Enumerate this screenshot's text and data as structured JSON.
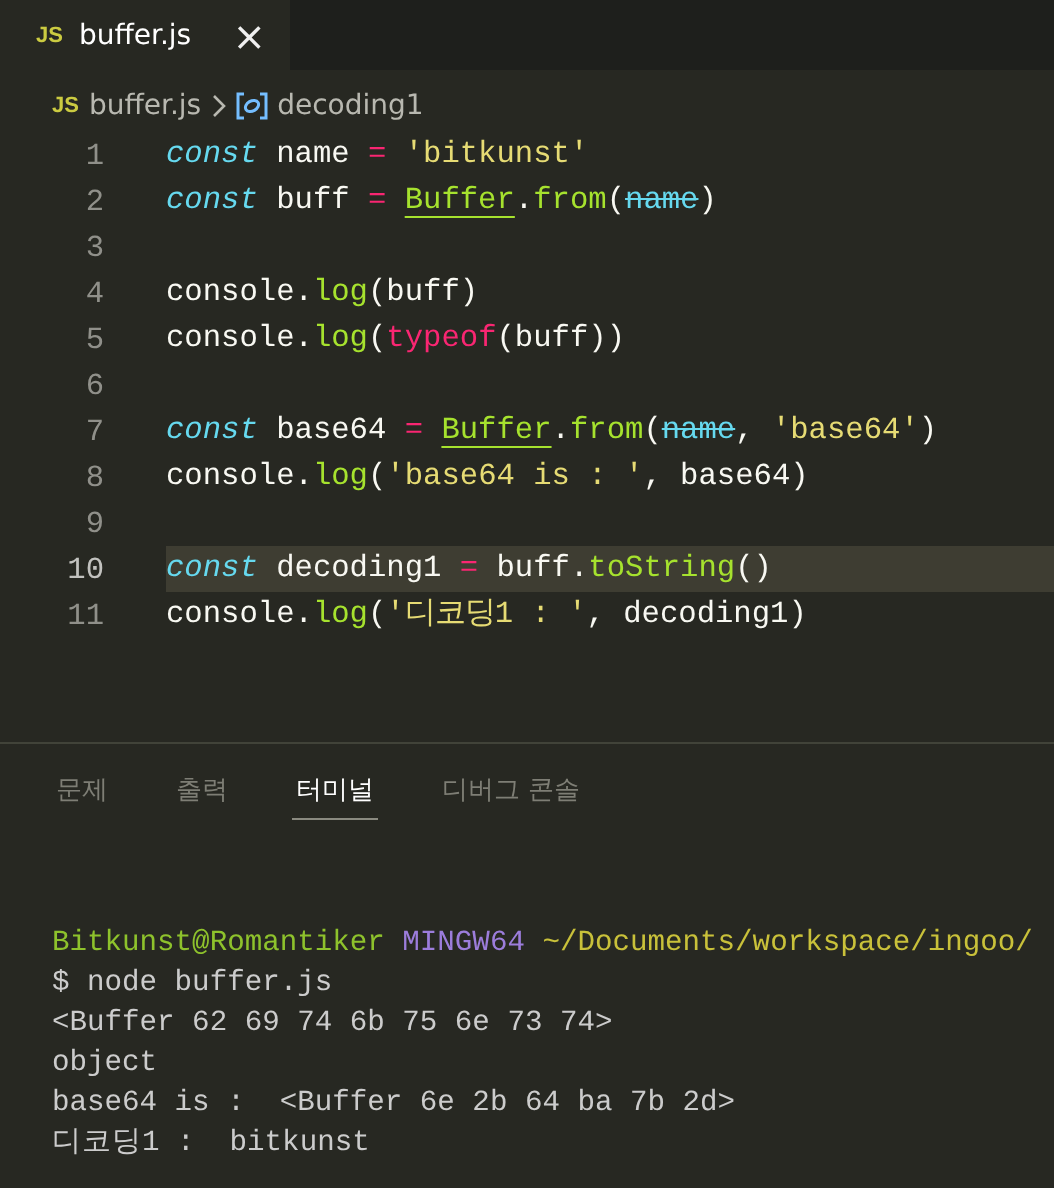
{
  "tab": {
    "icon": "JS",
    "title": "buffer.js",
    "close": "×",
    "selected": true
  },
  "breadcrumb": {
    "icon": "JS",
    "file": "buffer.js",
    "symbol": "decoding1"
  },
  "code_lines": [
    {
      "number": "1",
      "current": false,
      "tokens": [
        {
          "kind": "keyword",
          "text": "const"
        },
        {
          "kind": "plain",
          "text": " name "
        },
        {
          "kind": "operator",
          "text": "= "
        },
        {
          "kind": "string",
          "text": "'bitkunst'"
        }
      ]
    },
    {
      "number": "2",
      "current": false,
      "tokens": [
        {
          "kind": "keyword",
          "text": "const"
        },
        {
          "kind": "plain",
          "text": " buff "
        },
        {
          "kind": "operator",
          "text": "= "
        },
        {
          "kind": "class",
          "text": "Buffer"
        },
        {
          "kind": "plain",
          "text": "."
        },
        {
          "kind": "function",
          "text": "from"
        },
        {
          "kind": "plain",
          "text": "("
        },
        {
          "kind": "deprecated",
          "text": "name"
        },
        {
          "kind": "plain",
          "text": ")"
        }
      ]
    },
    {
      "number": "3",
      "current": false
    },
    {
      "number": "4",
      "current": false,
      "tokens": [
        {
          "kind": "plain",
          "text": "console."
        },
        {
          "kind": "function",
          "text": "log"
        },
        {
          "kind": "plain",
          "text": "(buff)"
        }
      ]
    },
    {
      "number": "5",
      "current": false,
      "tokens": [
        {
          "kind": "plain",
          "text": "console."
        },
        {
          "kind": "function",
          "text": "log"
        },
        {
          "kind": "plain",
          "text": "("
        },
        {
          "kind": "operator",
          "text": "typeof"
        },
        {
          "kind": "plain",
          "text": "(buff))"
        }
      ]
    },
    {
      "number": "6",
      "current": false
    },
    {
      "number": "7",
      "current": false,
      "tokens": [
        {
          "kind": "keyword",
          "text": "const"
        },
        {
          "kind": "plain",
          "text": " base64 "
        },
        {
          "kind": "operator",
          "text": "= "
        },
        {
          "kind": "class",
          "text": "Buffer"
        },
        {
          "kind": "plain",
          "text": "."
        },
        {
          "kind": "function",
          "text": "from"
        },
        {
          "kind": "plain",
          "text": "("
        },
        {
          "kind": "deprecated",
          "text": "name"
        },
        {
          "kind": "plain",
          "text": ", "
        },
        {
          "kind": "string",
          "text": "'base64'"
        },
        {
          "kind": "plain",
          "text": ")"
        }
      ]
    },
    {
      "number": "8",
      "current": false,
      "tokens": [
        {
          "kind": "plain",
          "text": "console."
        },
        {
          "kind": "function",
          "text": "log"
        },
        {
          "kind": "plain",
          "text": "("
        },
        {
          "kind": "string",
          "text": "'base64 is : '"
        },
        {
          "kind": "plain",
          "text": ", base64)"
        }
      ]
    },
    {
      "number": "9",
      "current": false
    },
    {
      "number": "10",
      "current": true,
      "tokens": [
        {
          "kind": "keyword",
          "text": "const"
        },
        {
          "kind": "plain",
          "text": " decoding1 "
        },
        {
          "kind": "operator",
          "text": "="
        },
        {
          "kind": "plain",
          "text": " buff."
        },
        {
          "kind": "function",
          "text": "toString"
        },
        {
          "kind": "plain",
          "text": "()"
        }
      ]
    },
    {
      "number": "11",
      "current": false,
      "tokens": [
        {
          "kind": "plain",
          "text": "console."
        },
        {
          "kind": "function",
          "text": "log"
        },
        {
          "kind": "plain",
          "text": "("
        },
        {
          "kind": "string",
          "text": "'디코딩1 : '"
        },
        {
          "kind": "plain",
          "text": ", decoding1)"
        }
      ]
    }
  ],
  "panel_tabs": [
    {
      "label": "문제",
      "selected": false
    },
    {
      "label": "출력",
      "selected": false
    },
    {
      "label": "터미널",
      "selected": true
    },
    {
      "label": "디버그 콘솔",
      "selected": false
    }
  ],
  "terminal_lines": [
    [
      {
        "kind": "user",
        "text": "Bitkunst@Romantiker "
      },
      {
        "kind": "system",
        "text": "MINGW64 "
      },
      {
        "kind": "path",
        "text": "~/Documents/workspace/ingoo/"
      }
    ],
    [
      {
        "kind": "plain",
        "text": "$ node buffer.js"
      }
    ],
    [
      {
        "kind": "plain",
        "text": "<Buffer 62 69 74 6b 75 6e 73 74>"
      }
    ],
    [
      {
        "kind": "plain",
        "text": "object"
      }
    ],
    [
      {
        "kind": "plain",
        "text": "base64 is :  <Buffer 6e 2b 64 ba 7b 2d>"
      }
    ],
    [
      {
        "kind": "plain",
        "text": "디코딩1 :  bitkunst"
      }
    ]
  ]
}
